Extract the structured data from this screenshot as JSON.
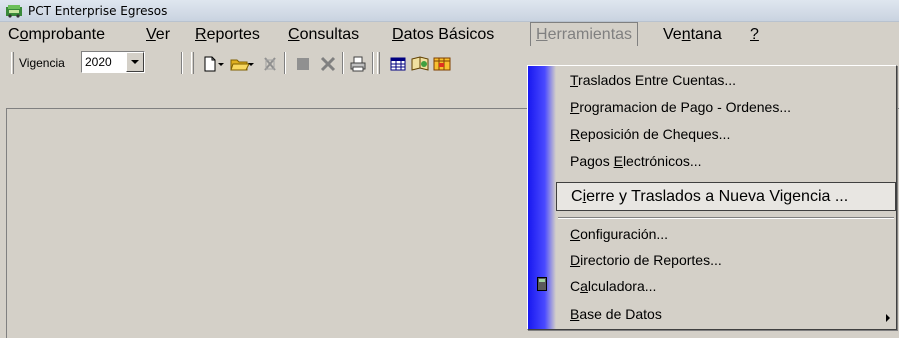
{
  "window": {
    "title": "PCT Enterprise Egresos",
    "icon": "app-icon"
  },
  "menubar": {
    "items": [
      {
        "pre": "C",
        "acc": "o",
        "post": "mprobante"
      },
      {
        "pre": "",
        "acc": "V",
        "post": "er"
      },
      {
        "pre": "",
        "acc": "R",
        "post": "eportes"
      },
      {
        "pre": "",
        "acc": "C",
        "post": "onsultas"
      },
      {
        "pre": "",
        "acc": "D",
        "post": "atos Básicos"
      },
      {
        "pre": "",
        "acc": "H",
        "post": "erramientas"
      },
      {
        "pre": "Ve",
        "acc": "n",
        "post": "tana"
      },
      {
        "pre": "",
        "acc": "?",
        "post": ""
      }
    ]
  },
  "toolbar": {
    "vigencia_label": "Vigencia",
    "vigencia_value": "2020",
    "buttons": [
      "new-document-icon",
      "dropdown-arrow-icon",
      "open-folder-icon",
      "dropdown-arrow-icon",
      "delete-icon",
      "stop-icon",
      "cancel-x-icon",
      "print-icon",
      "grid-icon",
      "book-icon",
      "report-icon"
    ]
  },
  "herramientas_menu": {
    "items": [
      {
        "pre": "",
        "acc": "T",
        "post": "raslados Entre Cuentas..."
      },
      {
        "pre": "",
        "acc": "P",
        "post": "rogramacion de Pago - Ordenes..."
      },
      {
        "pre": "",
        "acc": "R",
        "post": "eposición de Cheques..."
      },
      {
        "pre": "Pagos ",
        "acc": "E",
        "post": "lectrónicos..."
      },
      {
        "pre": "C",
        "acc": "i",
        "post": "erre y Traslados a Nueva Vigencia ..."
      },
      {
        "pre": "",
        "acc": "C",
        "post": "onfiguración..."
      },
      {
        "pre": "",
        "acc": "D",
        "post": "irectorio de Reportes..."
      },
      {
        "pre": "C",
        "acc": "a",
        "post": "lculadora..."
      },
      {
        "pre": "",
        "acc": "B",
        "post": "ase de Datos"
      }
    ],
    "selected_index": 4
  }
}
